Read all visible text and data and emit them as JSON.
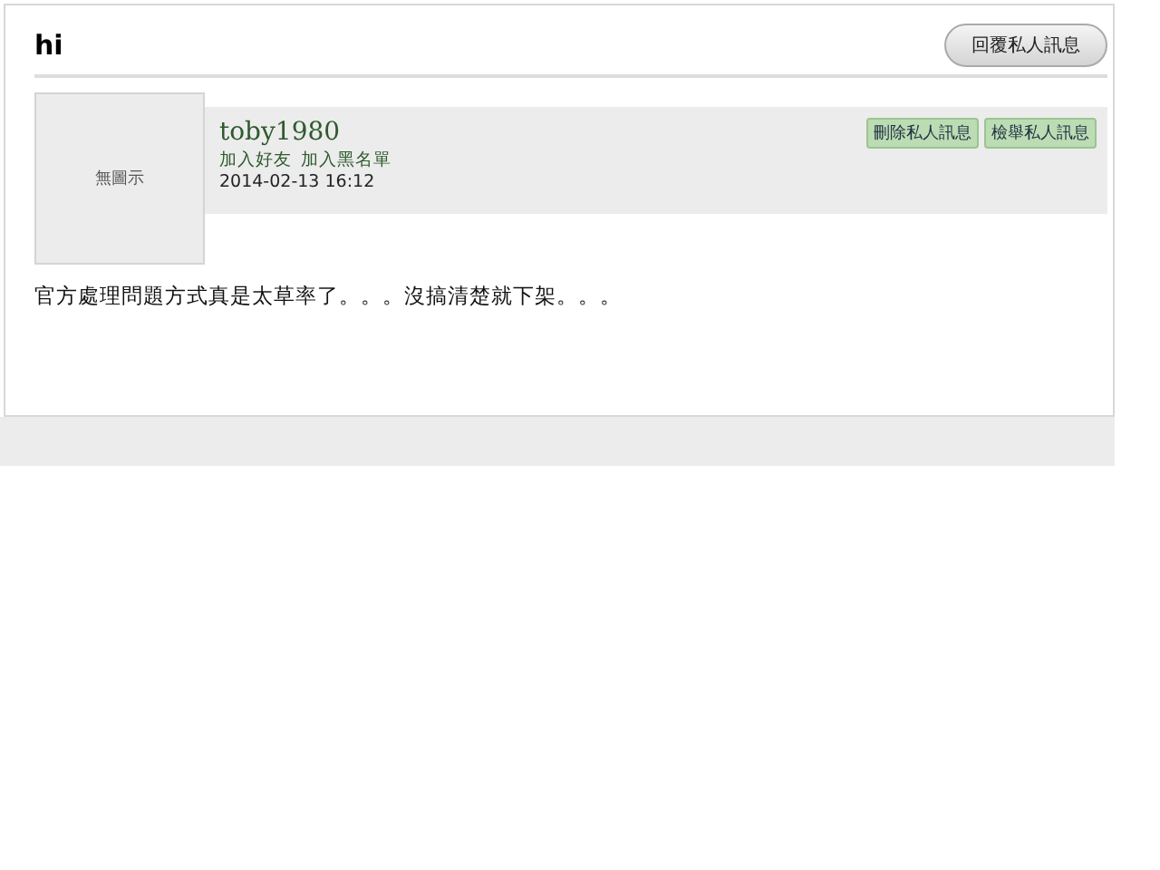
{
  "message": {
    "title": "hi",
    "reply_button": "回覆私人訊息",
    "avatar_placeholder": "無圖示",
    "sender": {
      "name": "toby1980",
      "links": [
        "加入好友",
        "加入黑名單"
      ],
      "date": "2014-02-13 16:12"
    },
    "actions": [
      "刪除私人訊息",
      "檢舉私人訊息"
    ],
    "body": "官方處理問題方式真是太草率了。。。沒搞清楚就下架。。。"
  }
}
